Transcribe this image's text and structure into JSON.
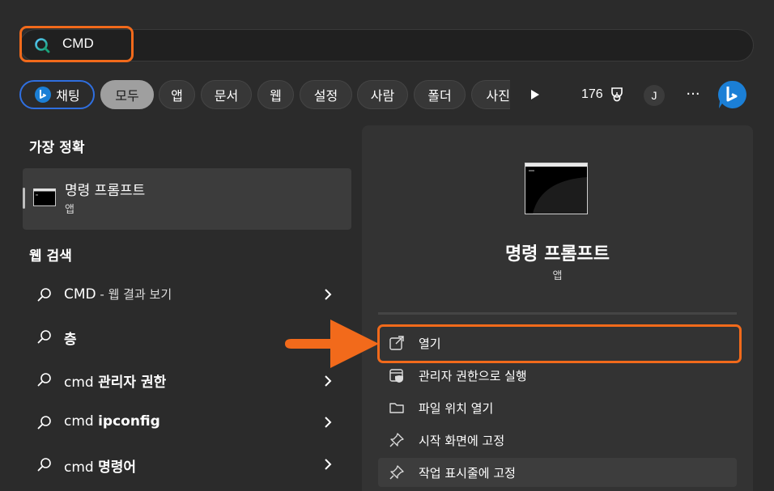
{
  "search": {
    "query": "CMD"
  },
  "filters": {
    "chat": "채팅",
    "items": [
      "모두",
      "앱",
      "문서",
      "웹",
      "설정",
      "사람",
      "폴더",
      "사진"
    ]
  },
  "header": {
    "points": "176",
    "avatar_initial": "J",
    "more": "···"
  },
  "best_match": {
    "section_title": "가장 정확",
    "title": "명령 프롬프트",
    "subtitle": "앱"
  },
  "web_search": {
    "section_title": "웹 검색",
    "items": [
      {
        "prefix": "CMD",
        "suffix": " - 웹 결과 보기"
      },
      {
        "prefix": "",
        "bold": "층"
      },
      {
        "prefix": "cmd ",
        "bold": "관리자 권한"
      },
      {
        "prefix": "cmd ",
        "bold": "ipconfig"
      },
      {
        "prefix": "cmd ",
        "bold": "명령어"
      }
    ]
  },
  "preview": {
    "title": "명령 프롬프트",
    "subtitle": "앱",
    "actions": [
      {
        "label": "열기",
        "icon": "open-external-icon"
      },
      {
        "label": "관리자 권한으로 실행",
        "icon": "shield-admin-icon"
      },
      {
        "label": "파일 위치 열기",
        "icon": "folder-icon"
      },
      {
        "label": "시작 화면에 고정",
        "icon": "pin-icon"
      },
      {
        "label": "작업 표시줄에 고정",
        "icon": "pin-icon"
      }
    ]
  },
  "colors": {
    "highlight": "#f26a1b",
    "chat_border": "#2f6fe0",
    "bing_blue": "#1b7fd6"
  }
}
